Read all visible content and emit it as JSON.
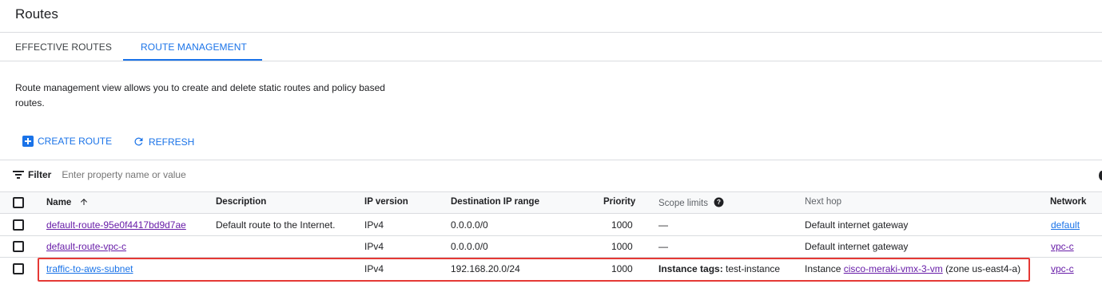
{
  "page": {
    "title": "Routes"
  },
  "tabs": [
    {
      "label": "EFFECTIVE ROUTES",
      "active": false
    },
    {
      "label": "ROUTE MANAGEMENT",
      "active": true
    }
  ],
  "description": "Route management view allows you to create and delete static routes and policy based routes.",
  "actions": {
    "create": "CREATE ROUTE",
    "refresh": "REFRESH"
  },
  "filter": {
    "label": "Filter",
    "placeholder": "Enter property name or value"
  },
  "table": {
    "headers": {
      "name": "Name",
      "description": "Description",
      "ip_version": "IP version",
      "dest_range": "Destination IP range",
      "priority": "Priority",
      "scope": "Scope limits",
      "next_hop": "Next hop",
      "network": "Network"
    },
    "rows": [
      {
        "name": "default-route-95e0f4417bd9d7ae",
        "description": "Default route to the Internet.",
        "ip_version": "IPv4",
        "dest_range": "0.0.0.0/0",
        "priority": "1000",
        "scope": "—",
        "next_hop": "Default internet gateway",
        "network": "default"
      },
      {
        "name": "default-route-vpc-c",
        "description": "",
        "ip_version": "IPv4",
        "dest_range": "0.0.0.0/0",
        "priority": "1000",
        "scope": "—",
        "next_hop": "Default internet gateway",
        "network": "vpc-c"
      },
      {
        "name": "traffic-to-aws-subnet",
        "description": "",
        "ip_version": "IPv4",
        "dest_range": "192.168.20.0/24",
        "priority": "1000",
        "scope_label": "Instance tags:",
        "scope_value": "test-instance",
        "next_hop_prefix": "Instance",
        "next_hop_link": "cisco-meraki-vmx-3-vm",
        "next_hop_suffix": "(zone us-east4-a)",
        "network": "vpc-c",
        "highlighted": true
      }
    ]
  },
  "colors": {
    "accent": "#1a73e8",
    "highlight": "#e53935",
    "link_visited": "#681da8"
  }
}
